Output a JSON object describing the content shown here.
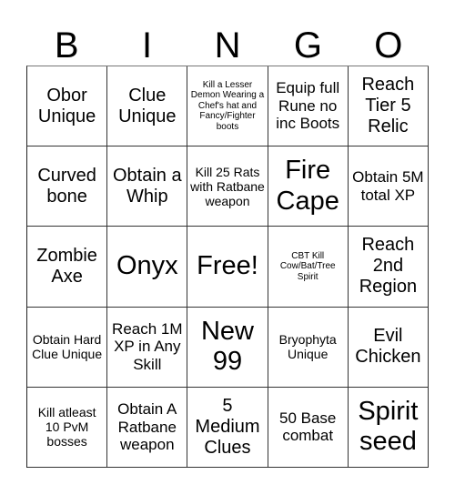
{
  "header": [
    "B",
    "I",
    "N",
    "G",
    "O"
  ],
  "cells": [
    [
      {
        "text": "Obor Unique",
        "size": "lg"
      },
      {
        "text": "Clue Unique",
        "size": "lg"
      },
      {
        "text": "Kill a Lesser Demon Wearing a Chef's hat and Fancy/Fighter boots",
        "size": "xs"
      },
      {
        "text": "Equip full Rune no inc Boots",
        "size": "md"
      },
      {
        "text": "Reach Tier 5 Relic",
        "size": "lg"
      }
    ],
    [
      {
        "text": "Curved bone",
        "size": "lg"
      },
      {
        "text": "Obtain a Whip",
        "size": "lg"
      },
      {
        "text": "Kill 25 Rats with Ratbane weapon",
        "size": "sm"
      },
      {
        "text": "Fire Cape",
        "size": "xl"
      },
      {
        "text": "Obtain 5M total XP",
        "size": "md"
      }
    ],
    [
      {
        "text": "Zombie Axe",
        "size": "lg"
      },
      {
        "text": "Onyx",
        "size": "xl"
      },
      {
        "text": "Free!",
        "size": "xl"
      },
      {
        "text": "CBT Kill Cow/Bat/Tree Spirit",
        "size": "xs"
      },
      {
        "text": "Reach 2nd Region",
        "size": "lg"
      }
    ],
    [
      {
        "text": "Obtain Hard Clue Unique",
        "size": "sm"
      },
      {
        "text": "Reach 1M XP in Any Skill",
        "size": "md"
      },
      {
        "text": "New 99",
        "size": "xl"
      },
      {
        "text": "Bryophyta Unique",
        "size": "sm"
      },
      {
        "text": "Evil Chicken",
        "size": "lg"
      }
    ],
    [
      {
        "text": "Kill atleast 10 PvM bosses",
        "size": "sm"
      },
      {
        "text": "Obtain A Ratbane weapon",
        "size": "md"
      },
      {
        "text": "5 Medium Clues",
        "size": "lg"
      },
      {
        "text": "50 Base combat",
        "size": "md"
      },
      {
        "text": "Spirit seed",
        "size": "xl"
      }
    ]
  ]
}
